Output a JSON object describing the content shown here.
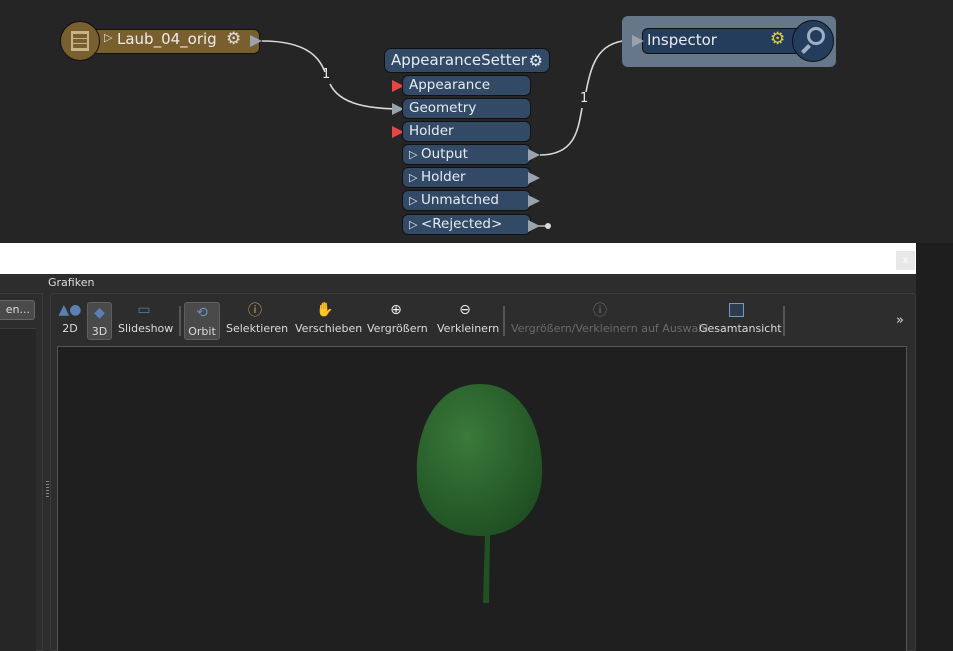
{
  "workspace": {
    "reader": {
      "name": "Laub_04_orig",
      "color": "#7a5f2e"
    },
    "transformer": {
      "name": "AppearanceSetter",
      "inputs": [
        "Appearance",
        "Geometry",
        "Holder"
      ],
      "outputs": [
        "Output",
        "Holder",
        "Unmatched",
        "<Rejected>"
      ]
    },
    "inspector": {
      "name": "Inspector"
    },
    "connections": [
      {
        "label": "1"
      },
      {
        "label": "1"
      }
    ]
  },
  "dialog": {
    "close": "x"
  },
  "panel": {
    "title": "Grafiken",
    "left_button": "en...",
    "toolbar": [
      {
        "label": "2D",
        "icon": "shapes-2d-icon"
      },
      {
        "label": "3D",
        "icon": "cube-3d-icon",
        "active": true
      },
      {
        "label": "Slideshow",
        "icon": "slideshow-icon"
      },
      {
        "label": "Orbit",
        "icon": "orbit-icon",
        "active": true
      },
      {
        "label": "Selektieren",
        "icon": "select-info-icon"
      },
      {
        "label": "Verschieben",
        "icon": "hand-icon"
      },
      {
        "label": "Vergrößern",
        "icon": "zoom-in-icon"
      },
      {
        "label": "Verkleinern",
        "icon": "zoom-out-icon"
      },
      {
        "label": "Vergrößern/Verkleinern auf Auswahl",
        "icon": "zoom-selection-icon",
        "disabled": true
      },
      {
        "label": "Gesamtansicht",
        "icon": "full-extent-icon"
      }
    ],
    "overflow": "»"
  },
  "colors": {
    "canvas": "#252525",
    "port": "#334a66",
    "required_port": "#e84545",
    "tree": "#2f6b2f"
  }
}
